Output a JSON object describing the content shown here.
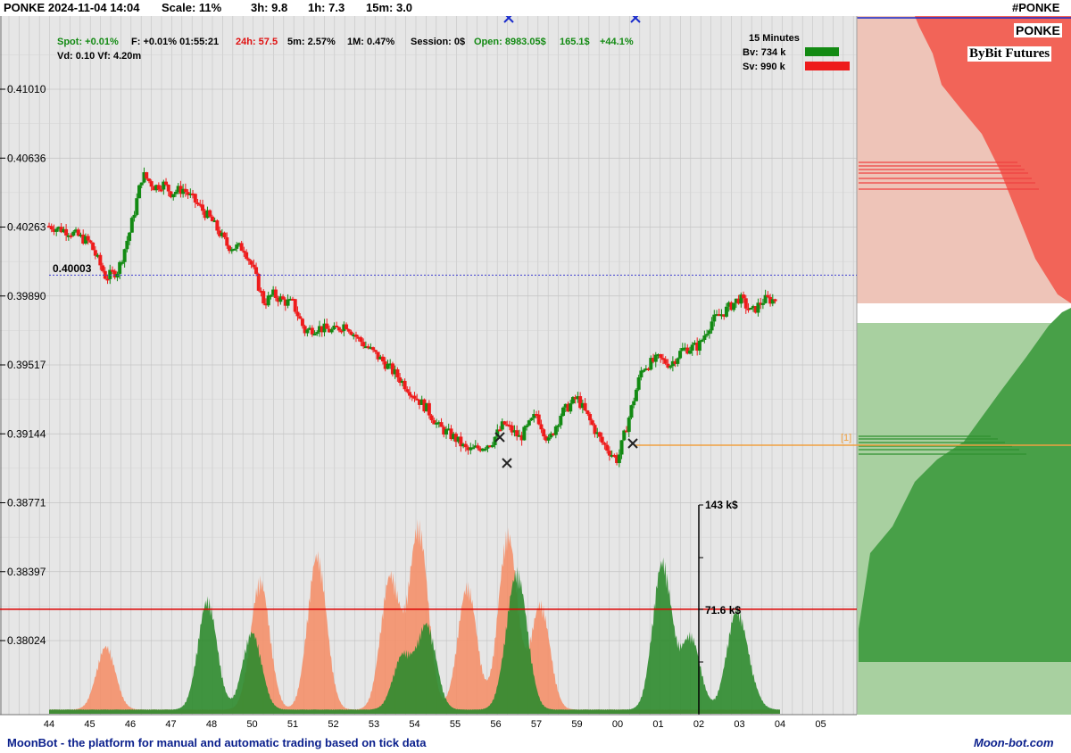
{
  "header": {
    "title": "PONKE 2024-11-04 14:04",
    "scale": "Scale: 11%",
    "h3": "3h:  9.8",
    "h1": "1h:  7.3",
    "m15": "15m:  3.0",
    "ticker": "#PONKE"
  },
  "info": {
    "spot": "Spot: +0.01%",
    "f": "F: +0.01% 01:55:21",
    "h24": "24h: 57.5",
    "m5": "5m: 2.57%",
    "m1": "1M: 0.47%",
    "session": "Session: 0$",
    "open": "Open: 8983.05$",
    "val": "165.1$",
    "pct": "+44.1%",
    "vd": "Vd: 0.10 Vf: 4.20m"
  },
  "legend": {
    "title": "15 Minutes",
    "bv": "Bv: 734 k",
    "sv": "Sv: 990 k"
  },
  "labels": {
    "symbol": "PONKE",
    "exchange": "ByBit Futures",
    "level": "0.40003",
    "order": "[1]",
    "vol_top": "143 k$",
    "vol_mid": "71.6 k$"
  },
  "footer": {
    "left": "MoonBot - the platform for manual and automatic trading based on tick data",
    "right": "Moon-bot.com"
  },
  "colors": {
    "buy": "#138a13",
    "sell": "#ee1c1c",
    "buy_volume": "#2e8b2e",
    "sell_volume": "#f4906a",
    "plot_bg": "#e6e6e6",
    "level_line": "#4040d0",
    "order_line": "#f0a040",
    "volume_line": "#dd0000"
  },
  "chart_data": {
    "type": "candlestick",
    "y_ticks": [
      "0.41010",
      "0.40636",
      "0.40263",
      "0.39890",
      "0.39517",
      "0.39144",
      "0.38771",
      "0.38397",
      "0.38024"
    ],
    "ylim": [
      0.3765,
      0.4135
    ],
    "x_ticks": [
      "44",
      "45",
      "46",
      "47",
      "48",
      "50",
      "51",
      "52",
      "53",
      "54",
      "55",
      "56",
      "57",
      "59",
      "00",
      "01",
      "02",
      "03",
      "04",
      "05"
    ],
    "price_path": {
      "x_index": [
        0,
        0.5,
        1.0,
        1.4,
        1.7,
        2.0,
        2.3,
        2.6,
        2.8,
        3.0,
        3.3,
        3.6,
        4.0,
        4.4,
        4.8,
        5.0,
        5.3,
        5.5,
        5.8,
        6.0,
        6.3,
        6.6,
        7.0,
        7.3,
        7.6,
        8.0,
        8.3,
        8.6,
        9.0,
        9.3,
        9.6,
        10.0,
        10.3,
        10.6,
        10.9,
        11.2,
        11.6,
        12.0,
        12.3,
        12.6,
        13.0,
        13.3,
        13.6,
        14.0,
        14.3,
        14.6,
        15.0,
        15.3,
        15.6,
        16.0,
        16.3,
        16.6,
        17.0,
        17.3,
        17.6,
        17.9
      ],
      "price": [
        0.4027,
        0.4024,
        0.4018,
        0.3999,
        0.4003,
        0.4025,
        0.4055,
        0.4048,
        0.405,
        0.4045,
        0.4047,
        0.404,
        0.403,
        0.4016,
        0.4015,
        0.4005,
        0.3985,
        0.399,
        0.3986,
        0.3985,
        0.397,
        0.3972,
        0.397,
        0.3974,
        0.3966,
        0.3958,
        0.3952,
        0.3945,
        0.3935,
        0.3928,
        0.3918,
        0.3912,
        0.3905,
        0.3907,
        0.391,
        0.392,
        0.3912,
        0.3925,
        0.391,
        0.3925,
        0.3934,
        0.3922,
        0.391,
        0.39,
        0.3925,
        0.395,
        0.3955,
        0.3952,
        0.396,
        0.3962,
        0.3975,
        0.398,
        0.3988,
        0.398,
        0.3987,
        0.3987
      ]
    },
    "volume_scale_max": 143,
    "volume_threshold": 71.6,
    "sell_volume_peaks": {
      "x_index": [
        1.4,
        5.2,
        6.6,
        8.4,
        9.1,
        10.3,
        11.3,
        12.1
      ],
      "value": [
        45,
        92,
        110,
        95,
        130,
        88,
        125,
        75
      ]
    },
    "buy_volume_peaks": {
      "x_index": [
        3.9,
        5.0,
        8.7,
        9.3,
        11.4,
        11.6,
        15.1,
        15.8,
        16.9,
        17.2
      ],
      "value": [
        78,
        55,
        38,
        60,
        45,
        62,
        105,
        52,
        62,
        18
      ]
    },
    "order_book": {
      "sell_side": "upper",
      "buy_side": "lower"
    }
  }
}
